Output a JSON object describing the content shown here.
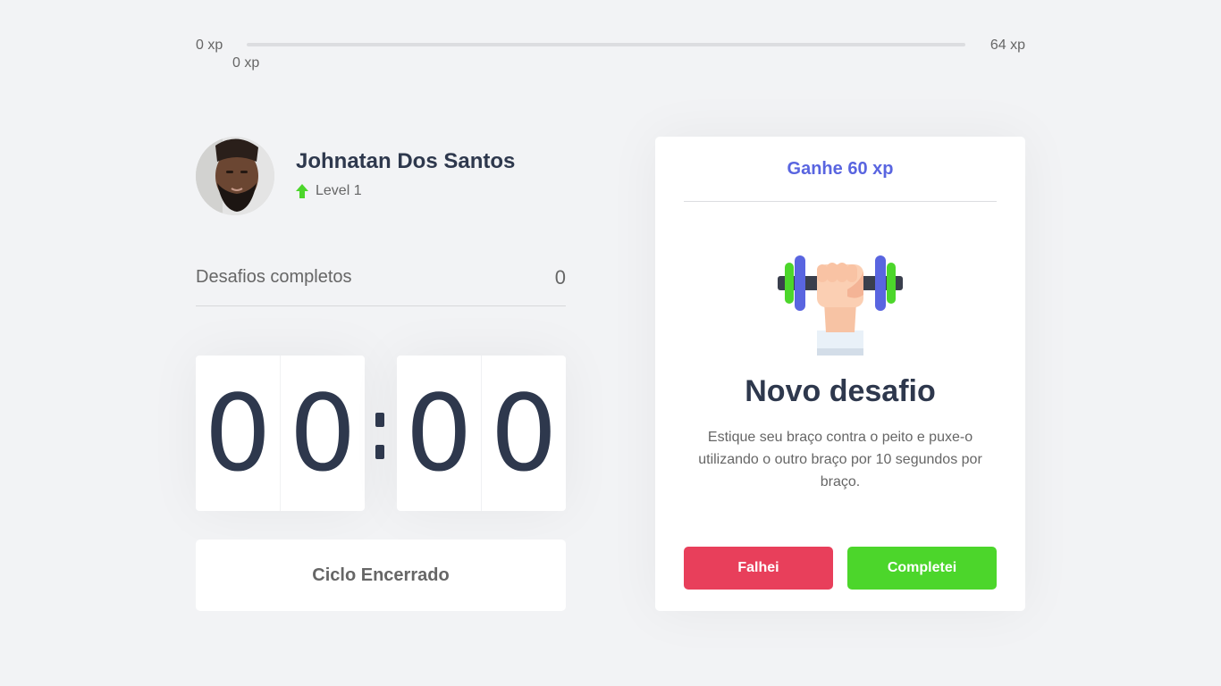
{
  "experience": {
    "min_label": "0 xp",
    "current_label": "0 xp",
    "max_label": "64 xp",
    "progress_fraction": 0.0,
    "fill_color": "#4cd62b"
  },
  "profile": {
    "name": "Johnatan Dos Santos",
    "level_label": "Level 1",
    "level_icon": "level-up-arrow-icon"
  },
  "challenges": {
    "completed_label": "Desafios completos",
    "completed_count": "0"
  },
  "countdown": {
    "minute_left": "0",
    "minute_right": "0",
    "second_left": "0",
    "second_right": "0"
  },
  "cycle": {
    "button_label": "Ciclo Encerrado"
  },
  "challenge_card": {
    "header": "Ganhe 60 xp",
    "image_icon": "dumbbell-body-icon",
    "title": "Novo desafio",
    "description": "Estique seu braço contra o peito e puxe-o utilizando o outro braço por 10 segundos por braço.",
    "fail_label": "Falhei",
    "success_label": "Completei"
  },
  "colors": {
    "accent": "#5965e0",
    "fail": "#e83f5b",
    "success": "#4cd62b",
    "title": "#2e384d",
    "text": "#666666",
    "background": "#f2f3f5"
  }
}
